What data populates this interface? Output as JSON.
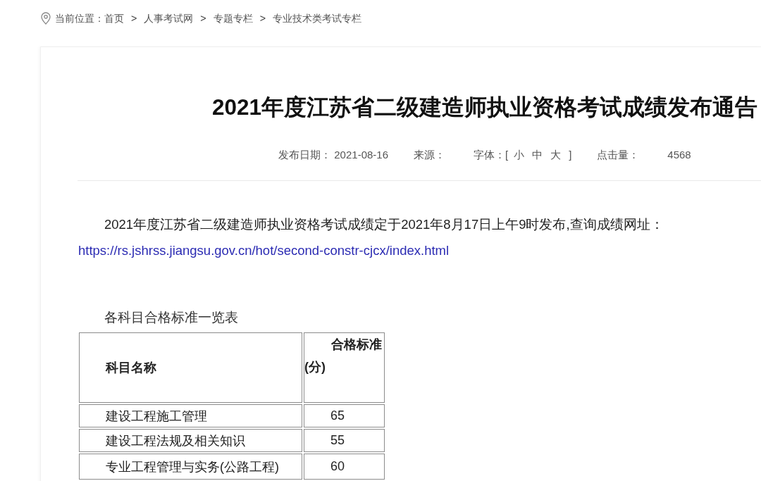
{
  "breadcrumb": {
    "label": "当前位置：",
    "parts": [
      {
        "kind": "link",
        "text": "首页"
      },
      {
        "kind": "separator",
        "text": ">"
      },
      {
        "kind": "link",
        "text": "人事考试网"
      },
      {
        "kind": "separator",
        "text": ">"
      },
      {
        "kind": "link",
        "text": "专题专栏"
      },
      {
        "kind": "separator",
        "text": ">"
      },
      {
        "kind": "link",
        "text": "专业技术类考试专栏"
      }
    ]
  },
  "article": {
    "title": "2021年度江苏省二级建造师执业资格考试成绩发布通告",
    "meta": {
      "date_label": "发布日期：",
      "date": "2021-08-16",
      "source_label": "来源：",
      "font_label": "字体：",
      "font_open": "[",
      "font_sizes": [
        "小",
        "中",
        "大"
      ],
      "font_close": "]",
      "hits_label": "点击量：",
      "hits": "4568"
    },
    "paragraph": "2021年度江苏省二级建造师执业资格考试成绩定于2021年8月17日上午9时发布,查询成绩网址：",
    "link": "https://rs.jshrss.jiangsu.gov.cn/hot/second-constr-cjcx/index.html",
    "table_caption": "各科目合格标准一览表",
    "table": {
      "columns": [
        "科目名称",
        "合格标准(分)"
      ],
      "rows": [
        [
          "建设工程施工管理",
          "65"
        ],
        [
          "建设工程法规及相关知识",
          "55"
        ],
        [
          "专业工程管理与实务(公路工程)",
          "60"
        ]
      ]
    }
  }
}
